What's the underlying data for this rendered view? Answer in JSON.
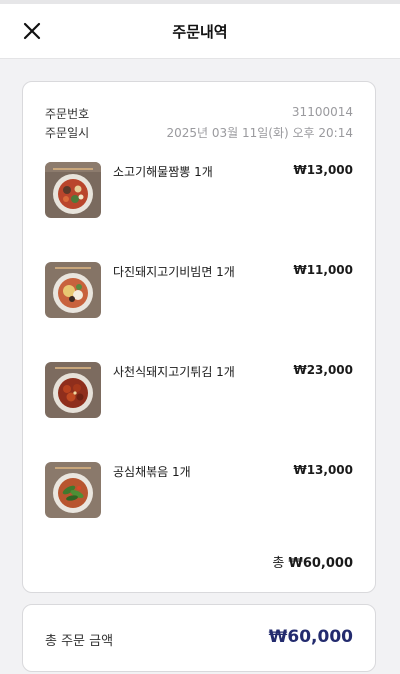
{
  "header": {
    "title": "주문내역",
    "close_icon": "close-icon"
  },
  "order": {
    "number_label": "주문번호",
    "number_value": "31100014",
    "date_label": "주문일시",
    "date_value": "2025년 03월 11일(화) 오후 20:14",
    "items": [
      {
        "name": "소고기해물짬뽕 1개",
        "price": "₩13,000"
      },
      {
        "name": "다진돼지고기비빔면 1개",
        "price": "₩11,000"
      },
      {
        "name": "사천식돼지고기튀김 1개",
        "price": "₩23,000"
      },
      {
        "name": "공심채볶음 1개",
        "price": "₩13,000"
      }
    ],
    "subtotal_prefix": "총",
    "subtotal_amount": "₩60,000"
  },
  "total": {
    "label": "총 주문 금액",
    "amount": "₩60,000"
  },
  "colors": {
    "accent": "#232b6e",
    "muted": "#9a9a9e",
    "background": "#f2f2f4"
  }
}
